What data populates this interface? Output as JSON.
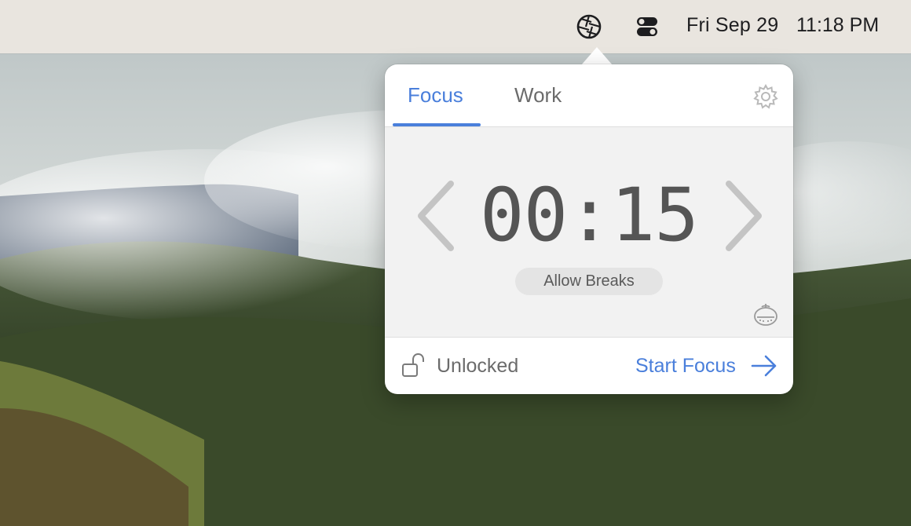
{
  "menubar": {
    "app_icon": "aperture-icon",
    "control_center_icon": "toggle-switches-icon",
    "date": "Fri Sep 29",
    "time": "11:18 PM"
  },
  "popover": {
    "tabs": [
      {
        "label": "Focus",
        "selected": true
      },
      {
        "label": "Work",
        "selected": false
      }
    ],
    "settings_icon": "gear-icon",
    "timer": {
      "value": "00:15",
      "decrement_icon": "chevron-left-icon",
      "increment_icon": "chevron-right-icon"
    },
    "allow_breaks_label": "Allow Breaks",
    "tomato_icon": "tomato-timer-icon",
    "footer": {
      "lock_icon": "unlocked-padlock-icon",
      "status_label": "Unlocked",
      "start_label": "Start Focus",
      "start_icon": "arrow-right-icon"
    }
  },
  "colors": {
    "accent": "#4a7fdb",
    "menubar_bg": "#e9e5df",
    "timer_text": "#555555",
    "muted_text": "#6b6b6b"
  }
}
